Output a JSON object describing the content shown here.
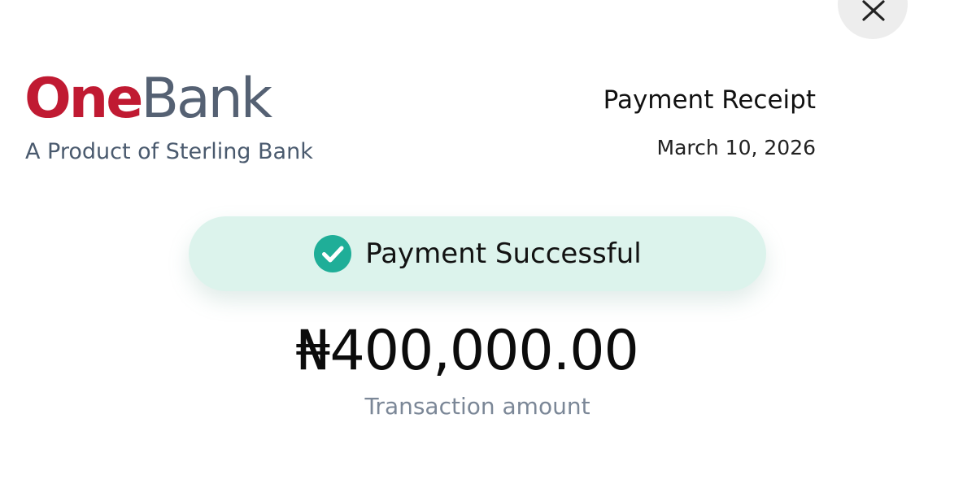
{
  "header": {
    "brand": {
      "logo_part1": "One",
      "logo_part2": "Bank",
      "tagline": "A Product of Sterling Bank"
    },
    "receipt": {
      "title": "Payment Receipt",
      "date": "March 10, 2026"
    }
  },
  "status": {
    "text": "Payment Successful",
    "icon": "check-circle-icon"
  },
  "transaction": {
    "amount": "₦400,000.00",
    "label": "Transaction amount"
  },
  "controls": {
    "close_icon": "close-icon"
  },
  "colors": {
    "brand_red": "#c01a32",
    "brand_slate": "#556173",
    "success_bg": "#dcf3ec",
    "success_icon": "#1fae98",
    "close_bg": "#ededed"
  }
}
